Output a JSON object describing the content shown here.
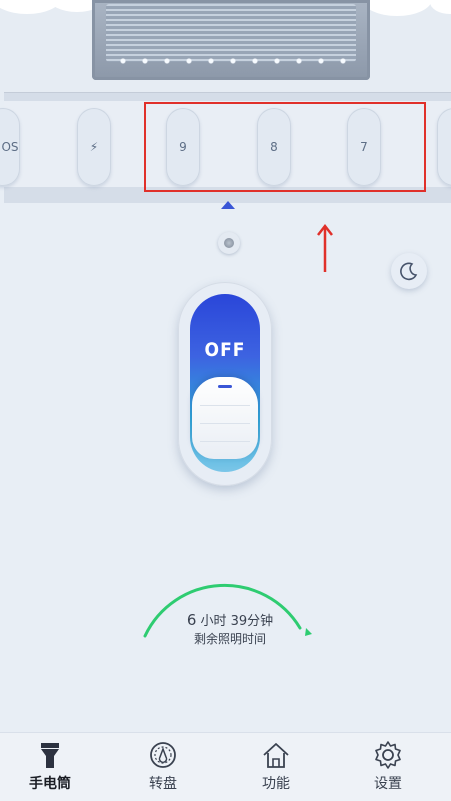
{
  "selector": {
    "items": [
      {
        "label": "OS"
      },
      {
        "label": "⚡"
      },
      {
        "label": "9"
      },
      {
        "label": "8"
      },
      {
        "label": "7"
      }
    ]
  },
  "switch": {
    "state_label": "OFF"
  },
  "timer": {
    "hours": "6",
    "rest": "小时 39分钟",
    "caption": "剩余照明时间"
  },
  "nav": {
    "items": [
      {
        "label": "手电筒",
        "icon": "flashlight-icon",
        "active": true
      },
      {
        "label": "转盘",
        "icon": "dial-icon",
        "active": false
      },
      {
        "label": "功能",
        "icon": "home-icon",
        "active": false
      },
      {
        "label": "设置",
        "icon": "gear-icon",
        "active": false
      }
    ]
  },
  "colors": {
    "accent": "#3a56d6",
    "highlight_box": "#e0302a",
    "arc": "#2ecc71"
  }
}
